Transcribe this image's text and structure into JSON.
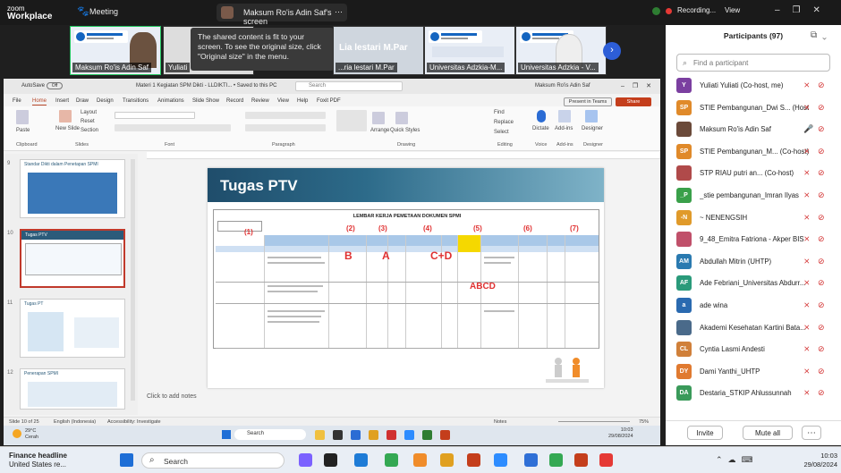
{
  "zoom": {
    "logo_line1": "zoom",
    "logo_line2": "Workplace",
    "meeting_label": "Meeting",
    "share_label": "Maksum Ro'is Adin Saf's screen",
    "recording_label": "Recording...",
    "view_label": "View"
  },
  "video_strip": {
    "tiles": [
      {
        "label": "Maksum Ro'is Adin Saf"
      },
      {
        "label": "Yuliati"
      },
      {
        "label": "...ria lestari M.Par"
      },
      {
        "label": "Universitas Adzkia-M..."
      },
      {
        "label": "Universitas Adzkia - V..."
      }
    ],
    "overlay_name": "Lia lestari M.Par",
    "tooltip": "The shared content is fit to your screen. To see the original size, click \"Original size\" in the menu."
  },
  "ppt": {
    "autosave": "AutoSave",
    "autosave_state": "Off",
    "doc_title": "Materi 1 Kegiatan SPM Dikti - LLDIKTI... • Saved to this PC",
    "search": "Search",
    "user": "Maksum Ro'is Adin Saf",
    "tabs": [
      "File",
      "Home",
      "Insert",
      "Draw",
      "Design",
      "Transitions",
      "Animations",
      "Slide Show",
      "Record",
      "Review",
      "View",
      "Help",
      "Foxit PDF"
    ],
    "present_label": "Present in Teams",
    "share_label": "Share",
    "groups": [
      "Clipboard",
      "Slides",
      "Font",
      "Paragraph",
      "Drawing",
      "Editing",
      "Voice",
      "Add-ins",
      "Designer"
    ],
    "ribbon_labels": {
      "paste": "Paste",
      "new_slide": "New Slide",
      "layout": "Layout",
      "reset": "Reset",
      "section": "Section",
      "find": "Find",
      "replace": "Replace",
      "select": "Select",
      "dictate": "Dictate",
      "addins": "Add-ins",
      "designer": "Designer",
      "arrange": "Arrange",
      "quick_styles": "Quick Styles"
    },
    "thumbs": [
      {
        "num": "9",
        "title": "Standar Dikti dalam Penetapan SPMI"
      },
      {
        "num": "10",
        "title": "Tugas PTV"
      },
      {
        "num": "11",
        "title": "Tugas PT"
      },
      {
        "num": "12",
        "title": "Penerapan SPMI"
      }
    ],
    "slide": {
      "title": "Tugas PTV",
      "doc_title": "LEMBAR KERJA PEMETAAN DOKUMEN SPMI",
      "col_nums": [
        "(1)",
        "(2)",
        "(3)",
        "(4)",
        "(5)",
        "(6)",
        "(7)"
      ],
      "letters": [
        "B",
        "A",
        "C+D",
        "ABCD"
      ]
    },
    "notes": "Click to add notes",
    "status": {
      "slide": "Slide 10 of 25",
      "lang": "English (Indonesia)",
      "access": "Accessibility: Investigate",
      "notes": "Notes",
      "zoom": "75%"
    },
    "taskbar": {
      "weather": "29°C",
      "weather2": "Cerah",
      "search": "Search",
      "time": "10:03",
      "date": "29/08/2024"
    }
  },
  "participants": {
    "header": "Participants (97)",
    "search_placeholder": "Find a participant",
    "list": [
      {
        "initials": "Y",
        "name": "Yuliati Yuliati (Co-host, me)",
        "color": "#7b3fa0",
        "mic": "muted"
      },
      {
        "initials": "SP",
        "name": "STIE Pembangunan_Dwi S... (Host)",
        "color": "#e08a2a",
        "mic": "muted"
      },
      {
        "initials": "",
        "name": "Maksum Ro'is Adin Saf",
        "color": "#6b4a3a",
        "mic": "on"
      },
      {
        "initials": "SP",
        "name": "STIE Pembangunan_M... (Co-host)",
        "color": "#e08a2a",
        "mic": "muted"
      },
      {
        "initials": "",
        "name": "STP RIAU putri an... (Co-host)",
        "color": "#b04a4a",
        "mic": "muted"
      },
      {
        "initials": "_P",
        "name": "_stie pembangunan_Imran Ilyas",
        "color": "#3aa04a",
        "mic": "muted"
      },
      {
        "initials": "-N",
        "name": "~ NENENGSIH",
        "color": "#e09a2a",
        "mic": "muted"
      },
      {
        "initials": "",
        "name": "9_48_Emitra Fatriona - Akper BIS",
        "color": "#c0506a",
        "mic": "muted"
      },
      {
        "initials": "AM",
        "name": "Abdullah Mitrin (UHTP)",
        "color": "#2a7ab0",
        "mic": "muted"
      },
      {
        "initials": "AF",
        "name": "Ade Febriani_Universitas Abdurr...",
        "color": "#2a9a7a",
        "mic": "muted"
      },
      {
        "initials": "a",
        "name": "ade wina",
        "color": "#2a6ab0",
        "mic": "muted"
      },
      {
        "initials": "",
        "name": "Akademi Kesehatan Kartini Bata...",
        "color": "#4a6a8a",
        "mic": "muted"
      },
      {
        "initials": "CL",
        "name": "Cyntia Lasmi Andesti",
        "color": "#d0803a",
        "mic": "muted"
      },
      {
        "initials": "DY",
        "name": "Dami Yanthi_UHTP",
        "color": "#e07a30",
        "mic": "muted"
      },
      {
        "initials": "DA",
        "name": "Destaria_STKIP Ahlussunnah",
        "color": "#3a9a5a",
        "mic": "muted"
      }
    ],
    "invite": "Invite",
    "mute_all": "Mute all"
  },
  "windows": {
    "news_title": "Finance headline",
    "news_sub": "United States re...",
    "search": "Search",
    "time": "10:03",
    "date": "29/08/2024"
  }
}
